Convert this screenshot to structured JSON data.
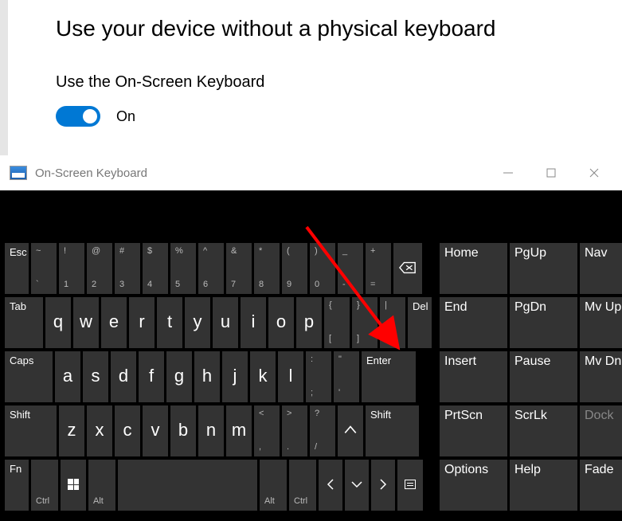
{
  "settings": {
    "heading": "Use your device without a physical keyboard",
    "toggle_label": "Use the On-Screen Keyboard",
    "toggle_state": "On"
  },
  "osk": {
    "title": "On-Screen Keyboard",
    "row1": {
      "esc": "Esc",
      "keys": [
        {
          "u": "~",
          "l": "`"
        },
        {
          "u": "!",
          "l": "1"
        },
        {
          "u": "@",
          "l": "2"
        },
        {
          "u": "#",
          "l": "3"
        },
        {
          "u": "$",
          "l": "4"
        },
        {
          "u": "%",
          "l": "5"
        },
        {
          "u": "^",
          "l": "6"
        },
        {
          "u": "&",
          "l": "7"
        },
        {
          "u": "*",
          "l": "8"
        },
        {
          "u": "(",
          "l": "9"
        },
        {
          "u": ")",
          "l": "0"
        },
        {
          "u": "_",
          "l": "-"
        },
        {
          "u": "+",
          "l": "="
        }
      ]
    },
    "row2": {
      "tab": "Tab",
      "letters": [
        "q",
        "w",
        "e",
        "r",
        "t",
        "y",
        "u",
        "i",
        "o",
        "p"
      ],
      "br1": {
        "u": "{",
        "l": "["
      },
      "br2": {
        "u": "}",
        "l": "]"
      },
      "bs": {
        "u": "|",
        "l": "\\"
      },
      "del": "Del"
    },
    "row3": {
      "caps": "Caps",
      "letters": [
        "a",
        "s",
        "d",
        "f",
        "g",
        "h",
        "j",
        "k",
        "l"
      ],
      "semi": {
        "u": ":",
        "l": ";"
      },
      "quote": {
        "u": "\"",
        "l": "'"
      },
      "enter": "Enter"
    },
    "row4": {
      "shift": "Shift",
      "letters": [
        "z",
        "x",
        "c",
        "v",
        "b",
        "n",
        "m"
      ],
      "comma": {
        "u": "<",
        "l": ","
      },
      "period": {
        "u": ">",
        "l": "."
      },
      "slash": {
        "u": "?",
        "l": "/"
      }
    },
    "row5": {
      "fn": "Fn",
      "ctrl": "Ctrl",
      "alt": "Alt"
    },
    "side": [
      [
        "Home",
        "PgUp",
        "Nav"
      ],
      [
        "End",
        "PgDn",
        "Mv Up"
      ],
      [
        "Insert",
        "Pause",
        "Mv Dn"
      ],
      [
        "PrtScn",
        "ScrLk",
        "Dock"
      ],
      [
        "Options",
        "Help",
        "Fade"
      ]
    ]
  }
}
